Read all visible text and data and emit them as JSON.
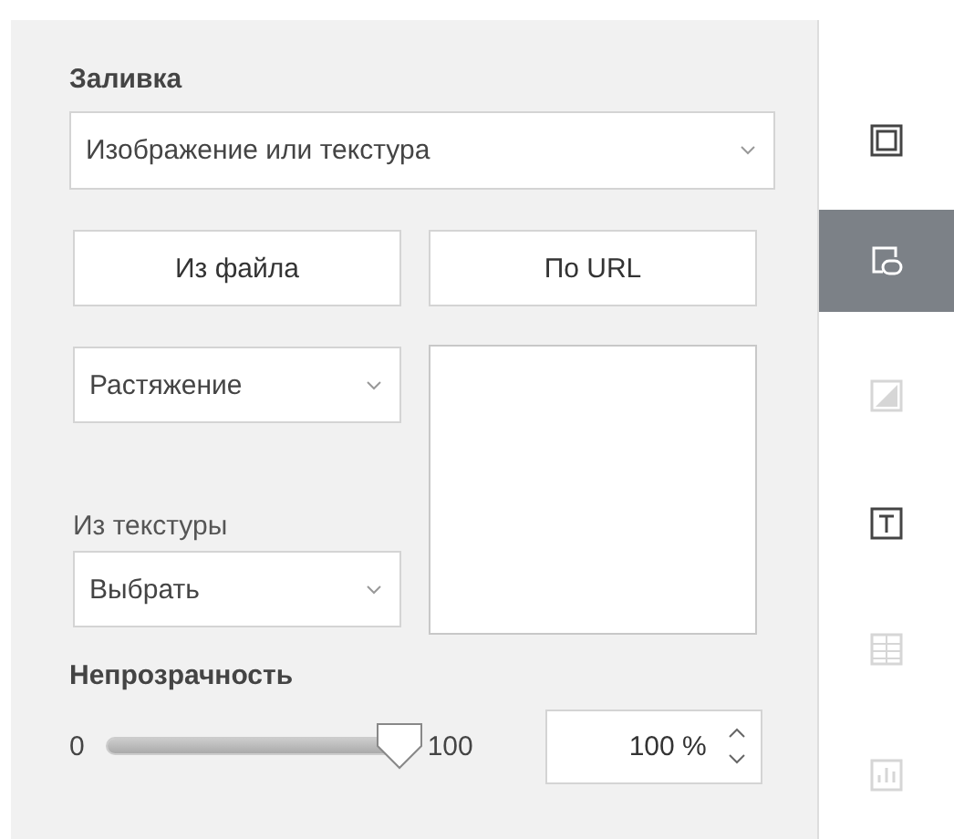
{
  "fill": {
    "title": "Заливка",
    "type_dropdown": {
      "value": "Изображение или текстура"
    },
    "buttons": [
      "Из файла",
      "По URL"
    ],
    "mode_dropdown": {
      "value": "Растяжение"
    },
    "texture_label": "Из текстуры",
    "texture_dropdown": {
      "value": "Выбрать"
    }
  },
  "opacity": {
    "title": "Непрозрачность",
    "min_label": "0",
    "max_label": "100",
    "level": 1,
    "value": "100 %"
  },
  "sidebar": {
    "items": [
      {
        "kind": "shape",
        "selected": false,
        "disabled": false
      },
      {
        "kind": "image",
        "selected": true,
        "disabled": false
      },
      {
        "kind": "picture",
        "selected": false,
        "disabled": true
      },
      {
        "kind": "text",
        "selected": false,
        "disabled": false
      },
      {
        "kind": "table",
        "selected": false,
        "disabled": true
      },
      {
        "kind": "chart",
        "selected": false,
        "disabled": true
      }
    ]
  }
}
